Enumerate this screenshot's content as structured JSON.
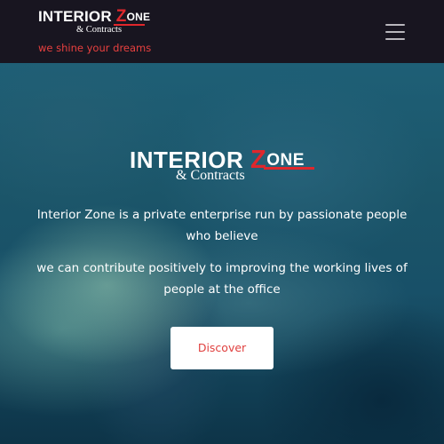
{
  "header": {
    "logo": {
      "main": "INTERIOR",
      "z": "Z",
      "one": "ONE",
      "sub": "& Contracts"
    },
    "tagline": "we shine your dreams",
    "menu_icon": "hamburger-menu-icon"
  },
  "hero": {
    "logo": {
      "main": "INTERIOR",
      "z": "Z",
      "one": "ONE",
      "sub": "& Contracts"
    },
    "paragraph_1": "Interior Zone is a private enterprise run by passionate people who believe",
    "paragraph_2": "we can contribute positively to improving the working lives of people at the office",
    "button_label": "Discover"
  },
  "colors": {
    "header_bg": "#181520",
    "accent_red": "#e0272c",
    "tagline": "#e8403f",
    "hero_base": "#1b5569",
    "button_bg": "#ffffff"
  }
}
